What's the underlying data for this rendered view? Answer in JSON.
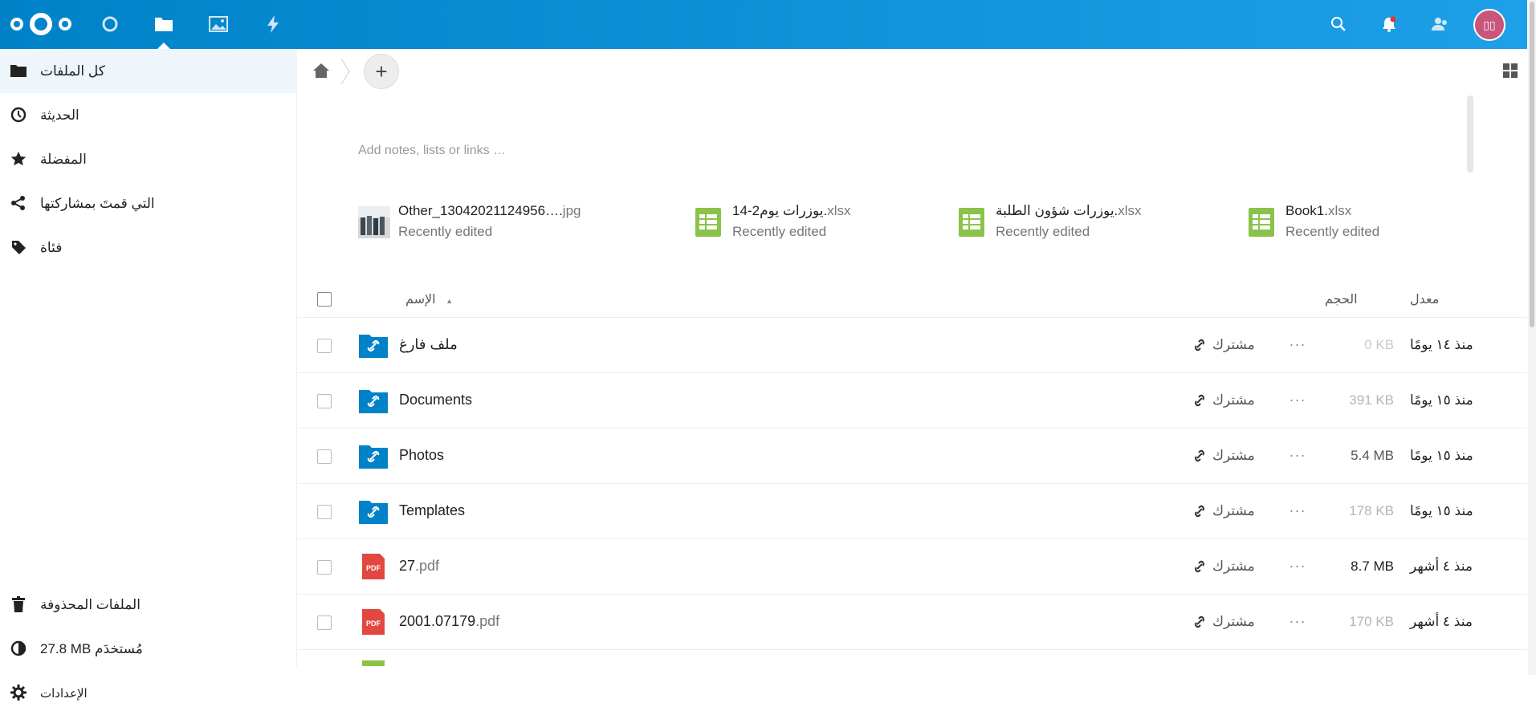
{
  "header": {
    "apps": [
      {
        "name": "dashboard-icon"
      },
      {
        "name": "files-icon"
      },
      {
        "name": "photos-icon"
      },
      {
        "name": "activity-icon"
      }
    ],
    "avatar_initials": "▯▯",
    "accent": "#0082c9"
  },
  "sidebar": {
    "items": [
      {
        "label": "كل الملفات",
        "icon": "folder-icon"
      },
      {
        "label": "الحديثة",
        "icon": "clock-icon"
      },
      {
        "label": "المفضلة",
        "icon": "star-icon"
      },
      {
        "label": "التي قمتَ بمشاركتها",
        "icon": "share-icon"
      },
      {
        "label": "فئاة",
        "icon": "tag-icon"
      }
    ],
    "bottom": {
      "trash_label": "الملفات المحذوفة",
      "quota_label": "27.8 MB مُستخدَم",
      "settings_label": "الإعدادات"
    }
  },
  "main": {
    "add_button": "+",
    "notes_placeholder": "Add notes, lists or links …",
    "recent": [
      {
        "base": "Other_13042021124956….",
        "ext": "jpg",
        "sub": "Recently edited"
      },
      {
        "base": "يوزرات يوم2-14.",
        "ext": "xlsx",
        "sub": "Recently edited"
      },
      {
        "base": "يوزرات شؤون الطلبة.",
        "ext": "xlsx",
        "sub": "Recently edited"
      },
      {
        "base": "Book1.",
        "ext": "xlsx",
        "sub": "Recently edited"
      }
    ],
    "table": {
      "col_name": "الإسم",
      "col_size": "الحجم",
      "col_modified": "معدل",
      "rows": [
        {
          "base": "ملف فارغ",
          "ext": "",
          "share": "مشترك",
          "more": "···",
          "size": "0 KB",
          "modified": "منذ ١٤ يومًا"
        },
        {
          "base": "Documents",
          "ext": "",
          "share": "مشترك",
          "more": "···",
          "size": "391 KB",
          "modified": "منذ ١٥ يومًا"
        },
        {
          "base": "Photos",
          "ext": "",
          "share": "مشترك",
          "more": "···",
          "size": "5.4 MB",
          "modified": "منذ ١٥ يومًا"
        },
        {
          "base": "Templates",
          "ext": "",
          "share": "مشترك",
          "more": "···",
          "size": "178 KB",
          "modified": "منذ ١٥ يومًا"
        },
        {
          "base": "27",
          "ext": ".pdf",
          "share": "مشترك",
          "more": "···",
          "size": "8.7 MB",
          "modified": "منذ ٤ أشهر"
        },
        {
          "base": "2001.07179",
          "ext": ".pdf",
          "share": "مشترك",
          "more": "···",
          "size": "170 KB",
          "modified": "منذ ٤ أشهر"
        }
      ]
    }
  }
}
